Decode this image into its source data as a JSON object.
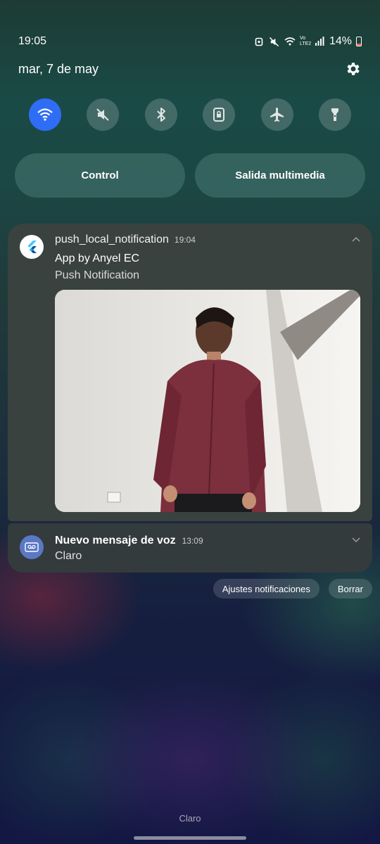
{
  "status_bar": {
    "time": "19:05",
    "network_label": "Vo LTE2",
    "battery": "14%",
    "icons": [
      "alarm-icon",
      "mute-icon",
      "wifi-icon",
      "volte-icon",
      "signal-icon",
      "battery-icon"
    ]
  },
  "header": {
    "date": "mar, 7 de may",
    "settings_icon": "gear-icon"
  },
  "quick_settings": [
    {
      "name": "wifi",
      "icon": "wifi-icon",
      "active": true
    },
    {
      "name": "sound",
      "icon": "mute-icon",
      "active": false
    },
    {
      "name": "bluetooth",
      "icon": "bluetooth-icon",
      "active": false
    },
    {
      "name": "rotation-lock",
      "icon": "lock-icon",
      "active": false
    },
    {
      "name": "airplane",
      "icon": "airplane-icon",
      "active": false
    },
    {
      "name": "flashlight",
      "icon": "flashlight-icon",
      "active": false
    }
  ],
  "pills": {
    "control": "Control",
    "media_output": "Salida multimedia"
  },
  "notifications": {
    "push": {
      "app_name": "push_local_notification",
      "time": "19:04",
      "title": "App by Anyel EC",
      "body": "Push Notification",
      "icon": "flutter-icon"
    },
    "voicemail": {
      "title": "Nuevo mensaje de voz",
      "time": "13:09",
      "body": "Claro",
      "icon": "voicemail-icon"
    }
  },
  "actions": {
    "settings": "Ajustes notificaciones",
    "clear": "Borrar"
  },
  "footer": {
    "carrier": "Claro"
  },
  "colors": {
    "accent": "#2f6df6",
    "card": "#3a4240",
    "battery_low": "#ff6a4d"
  }
}
